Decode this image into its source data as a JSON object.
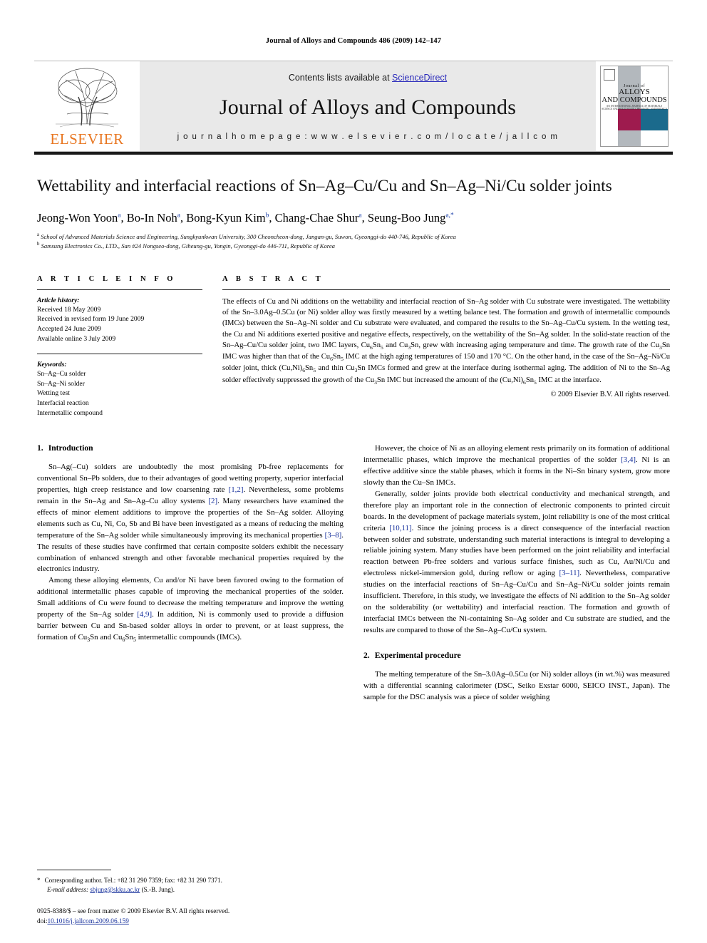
{
  "running_head": "Journal of Alloys and Compounds 486 (2009) 142–147",
  "masthead": {
    "contents_prefix": "Contents lists available at ",
    "sciencedirect": "ScienceDirect",
    "journal_title": "Journal of Alloys and Compounds",
    "homepage": "j o u r n a l   h o m e p a g e :   w w w . e l s e v i e r . c o m / l o c a t e / j a l l c o m",
    "publisher": "ELSEVIER",
    "cover": {
      "line1": "Journal of",
      "line2": "ALLOYS",
      "line3": "AND COMPOUNDS",
      "line4": "AN INTERNATIONAL JOURNAL OF MATERIALS SCIENCE AND SOLID STATE CHEMISTRY AND PHYSICS"
    },
    "accent_orange": "#E87722",
    "link_blue": "#2b2bbb",
    "band_gray": "#e9e9e9",
    "cover_magenta": "#9e1b4e",
    "cover_teal": "#1b6a8c",
    "cover_gray": "#b3b8bd"
  },
  "article": {
    "title": "Wettability and interfacial reactions of Sn–Ag–Cu/Cu and Sn–Ag–Ni/Cu solder joints",
    "authors_html": "Jeong-Won Yoon<sup>a</sup>, Bo-In Noh<sup>a</sup>, Bong-Kyun Kim<sup>b</sup>, Chang-Chae Shur<sup>a</sup>, Seung-Boo Jung<sup>a,*</sup>",
    "affiliation_a": "School of Advanced Materials Science and Engineering, Sungkyunkwan University, 300 Cheoncheon-dong, Jangan-gu, Suwon, Gyeonggi-do 440-746, Republic of Korea",
    "affiliation_b": "Samsung Electronics Co., LTD., San #24 Nongseo-dong, Giheung-gu, Yongin, Gyeonggi-do 446-711, Republic of Korea"
  },
  "article_info": {
    "heading": "A R T I C L E   I N F O",
    "history_label": "Article history:",
    "history": [
      "Received 18 May 2009",
      "Received in revised form 19 June 2009",
      "Accepted 24 June 2009",
      "Available online 3 July 2009"
    ],
    "keywords_label": "Keywords:",
    "keywords": [
      "Sn–Ag–Cu solder",
      "Sn–Ag–Ni solder",
      "Wetting test",
      "Interfacial reaction",
      "Intermetallic compound"
    ]
  },
  "abstract": {
    "heading": "A B S T R A C T",
    "body_html": "The effects of Cu and Ni additions on the wettability and interfacial reaction of Sn–Ag solder with Cu substrate were investigated. The wettability of the Sn–3.0Ag–0.5Cu (or Ni) solder alloy was firstly measured by a wetting balance test. The formation and growth of intermetallic compounds (IMCs) between the Sn–Ag–Ni solder and Cu substrate were evaluated, and compared the results to the Sn–Ag–Cu/Cu system. In the wetting test, the Cu and Ni additions exerted positive and negative effects, respectively, on the wettability of the Sn–Ag solder. In the solid-state reaction of the Sn–Ag–Cu/Cu solder joint, two IMC layers, Cu<sub>6</sub>Sn<sub>5</sub> and Cu<sub>3</sub>Sn, grew with increasing aging temperature and time. The growth rate of the Cu<sub>3</sub>Sn IMC was higher than that of the Cu<sub>6</sub>Sn<sub>5</sub> IMC at the high aging temperatures of 150 and 170 °C. On the other hand, in the case of the Sn–Ag–Ni/Cu solder joint, thick (Cu,Ni)<sub>6</sub>Sn<sub>5</sub> and thin Cu<sub>3</sub>Sn IMCs formed and grew at the interface during isothermal aging. The addition of Ni to the Sn–Ag solder effectively suppressed the growth of the Cu<sub>3</sub>Sn IMC but increased the amount of the (Cu,Ni)<sub>6</sub>Sn<sub>5</sub> IMC at the interface.",
    "copyright": "© 2009 Elsevier B.V. All rights reserved."
  },
  "sections": {
    "introduction": {
      "number": "1.",
      "title": "Introduction",
      "paragraphs_html": [
        "Sn–Ag(–Cu) solders are undoubtedly the most promising Pb-free replacements for conventional Sn–Pb solders, due to their advantages of good wetting property, superior interfacial properties, high creep resistance and low coarsening rate <span class=\"ref\">[1,2]</span>. Nevertheless, some problems remain in the Sn–Ag and Sn–Ag–Cu alloy systems <span class=\"ref\">[2]</span>. Many researchers have examined the effects of minor element additions to improve the properties of the Sn–Ag solder. Alloying elements such as Cu, Ni, Co, Sb and Bi have been investigated as a means of reducing the melting temperature of the Sn–Ag solder while simultaneously improving its mechanical properties <span class=\"ref\">[3–8]</span>. The results of these studies have confirmed that certain composite solders exhibit the necessary combination of enhanced strength and other favorable mechanical properties required by the electronics industry.",
        "Among these alloying elements, Cu and/or Ni have been favored owing to the formation of additional intermetallic phases capable of improving the mechanical properties of the solder. Small additions of Cu were found to decrease the melting temperature and improve the wetting property of the Sn–Ag solder <span class=\"ref\">[4,9]</span>. In addition, Ni is commonly used to provide a diffusion barrier between Cu and Sn-based solder alloys in order to prevent, or at least suppress, the formation of Cu<sub>3</sub>Sn and Cu<sub>6</sub>Sn<sub>5</sub> intermetallic compounds (IMCs).",
        "However, the choice of Ni as an alloying element rests primarily on its formation of additional intermetallic phases, which improve the mechanical properties of the solder <span class=\"ref\">[3,4]</span>. Ni is an effective additive since the stable phases, which it forms in the Ni–Sn binary system, grow more slowly than the Cu–Sn IMCs.",
        "Generally, solder joints provide both electrical conductivity and mechanical strength, and therefore play an important role in the connection of electronic components to printed circuit boards. In the development of package materials system, joint reliability is one of the most critical criteria <span class=\"ref\">[10,11]</span>. Since the joining process is a direct consequence of the interfacial reaction between solder and substrate, understanding such material interactions is integral to developing a reliable joining system. Many studies have been performed on the joint reliability and interfacial reaction between Pb-free solders and various surface finishes, such as Cu, Au/Ni/Cu and electroless nickel-immersion gold, during reflow or aging <span class=\"ref\">[3–11]</span>. Nevertheless, comparative studies on the interfacial reactions of Sn–Ag–Cu/Cu and Sn–Ag–Ni/Cu solder joints remain insufficient. Therefore, in this study, we investigate the effects of Ni addition to the Sn–Ag solder on the solderability (or wettability) and interfacial reaction. The formation and growth of interfacial IMCs between the Ni-containing Sn–Ag solder and Cu substrate are studied, and the results are compared to those of the Sn–Ag–Cu/Cu system."
      ]
    },
    "experimental": {
      "number": "2.",
      "title": "Experimental procedure",
      "paragraphs_html": [
        "The melting temperature of the Sn–3.0Ag–0.5Cu (or Ni) solder alloys (in wt.%) was measured with a differential scanning calorimeter (DSC, Seiko Exstar 6000, SEICO INST., Japan). The sample for the DSC analysis was a piece of solder weighing"
      ]
    }
  },
  "footnotes": {
    "corresponding_star": "*",
    "corresponding_html": "Corresponding author. Tel.: +82 31 290 7359; fax: +82 31 290 7371.",
    "email_label": "E-mail address:",
    "email": "sbjung@skku.ac.kr",
    "email_suffix": "(S.-B. Jung).",
    "issn_line": "0925-8388/$ – see front matter © 2009 Elsevier B.V. All rights reserved.",
    "doi_label": "doi:",
    "doi": "10.1016/j.jallcom.2009.06.159"
  }
}
